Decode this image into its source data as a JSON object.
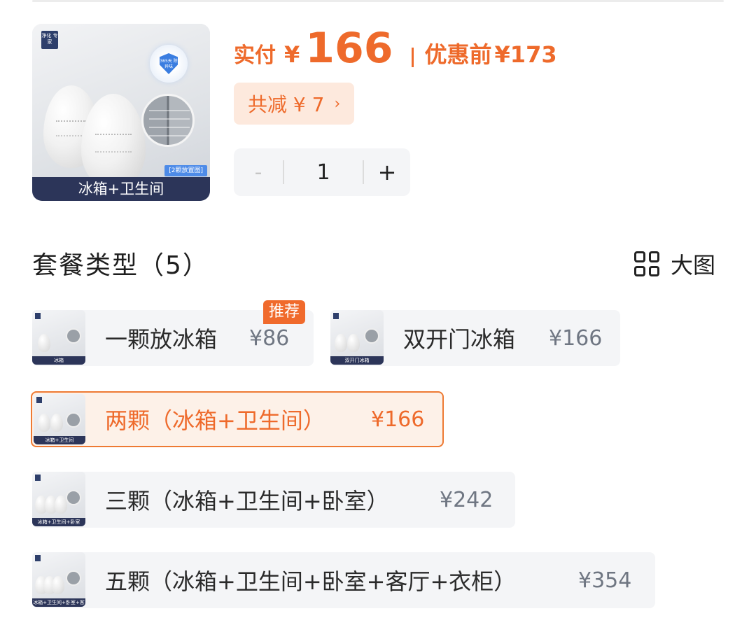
{
  "product": {
    "image_caption": "冰箱+卫生间",
    "image_tag": "[2颗放置图]",
    "image_logo": "净化 专家",
    "image_badge": "365天 除异味"
  },
  "price": {
    "paid_label": "实付",
    "currency": "¥",
    "paid_value": "166",
    "original_label": "优惠前",
    "original_value": "¥173",
    "discount_text": "共减 ¥ 7",
    "discount_arrow": "›"
  },
  "stepper": {
    "minus": "-",
    "quantity": "1",
    "plus": "+"
  },
  "section": {
    "title": "套餐类型（5）",
    "big_view_label": "大图"
  },
  "recommend_tag": "推荐",
  "options": [
    {
      "label": "一颗放冰箱",
      "price": "¥86",
      "thumb_caption": "冰箱",
      "selected": false
    },
    {
      "label": "双开门冰箱",
      "price": "¥166",
      "thumb_caption": "双开门冰箱",
      "selected": false
    },
    {
      "label": "两颗（冰箱+卫生间）",
      "price": "¥166",
      "thumb_caption": "冰箱+卫生间",
      "selected": true
    },
    {
      "label": "三颗（冰箱+卫生间+卧室）",
      "price": "¥242",
      "thumb_caption": "冰箱+卫生间+卧室",
      "selected": false
    },
    {
      "label": "五颗（冰箱+卫生间+卧室+客厅+衣柜）",
      "price": "¥354",
      "thumb_caption": "冰箱+卫生间+卧室+客厅+衣柜",
      "selected": false
    }
  ],
  "colors": {
    "accent": "#ee6a2b",
    "accent_bg": "#fde9dd",
    "option_bg": "#f4f5f7",
    "muted_price": "#6f7682"
  }
}
